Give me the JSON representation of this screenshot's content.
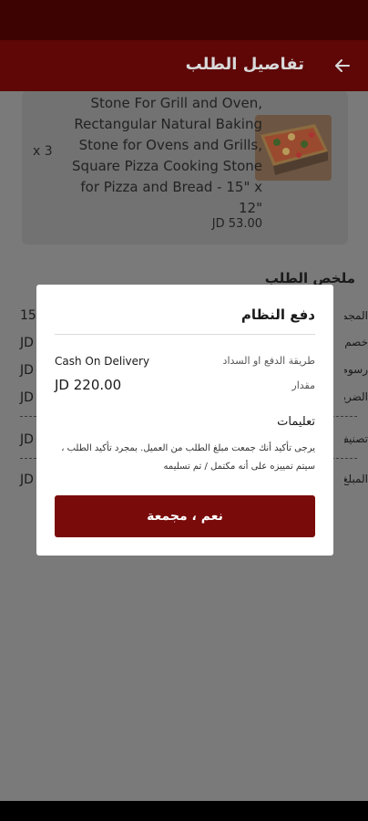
{
  "app_bar": {
    "title": "تفاصيل الطلب",
    "back_icon": "arrow-back-icon"
  },
  "product": {
    "title": "Stone For Grill and Oven, Rectangular Natural Baking Stone for Ovens and Grills, Square Pizza Cooking Stone for Pizza and Bread - 15\" x 12\"",
    "price": "JD 53.00",
    "quantity": "x 3",
    "image_icon": "pizza-image"
  },
  "summary": {
    "title": "ملخص الطلب",
    "rows": [
      {
        "label": "المجموع الفرعي",
        "value": "15"
      },
      {
        "label": "خصم",
        "value": "JD"
      },
      {
        "label": "رسوم التوصيل",
        "value": "JD"
      },
      {
        "label": "الضريبة",
        "value": "JD"
      },
      {
        "label": "تصنيف",
        "value": "JD"
      },
      {
        "label": "المبلغ",
        "value": "JD"
      }
    ]
  },
  "dialog": {
    "title": "دفع النظام",
    "payment_method_label": "طريقة الدفع او السداد",
    "payment_method_value": "Cash On Delivery",
    "amount_label": "مقدار",
    "amount_value": "JD 220.00",
    "instructions_title": "تعليمات",
    "instructions_text": "يرجى تأكيد أنك جمعت مبلغ الطلب من العميل. بمجرد تأكيد الطلب ، سيتم تمييزه على أنه مكتمل / تم تسليمه",
    "confirm_button": "نعم ، مجمعة"
  },
  "colors": {
    "primary": "#7a0b0b",
    "app_bar": "#5f0606",
    "scrim": "#7a7a7a"
  }
}
